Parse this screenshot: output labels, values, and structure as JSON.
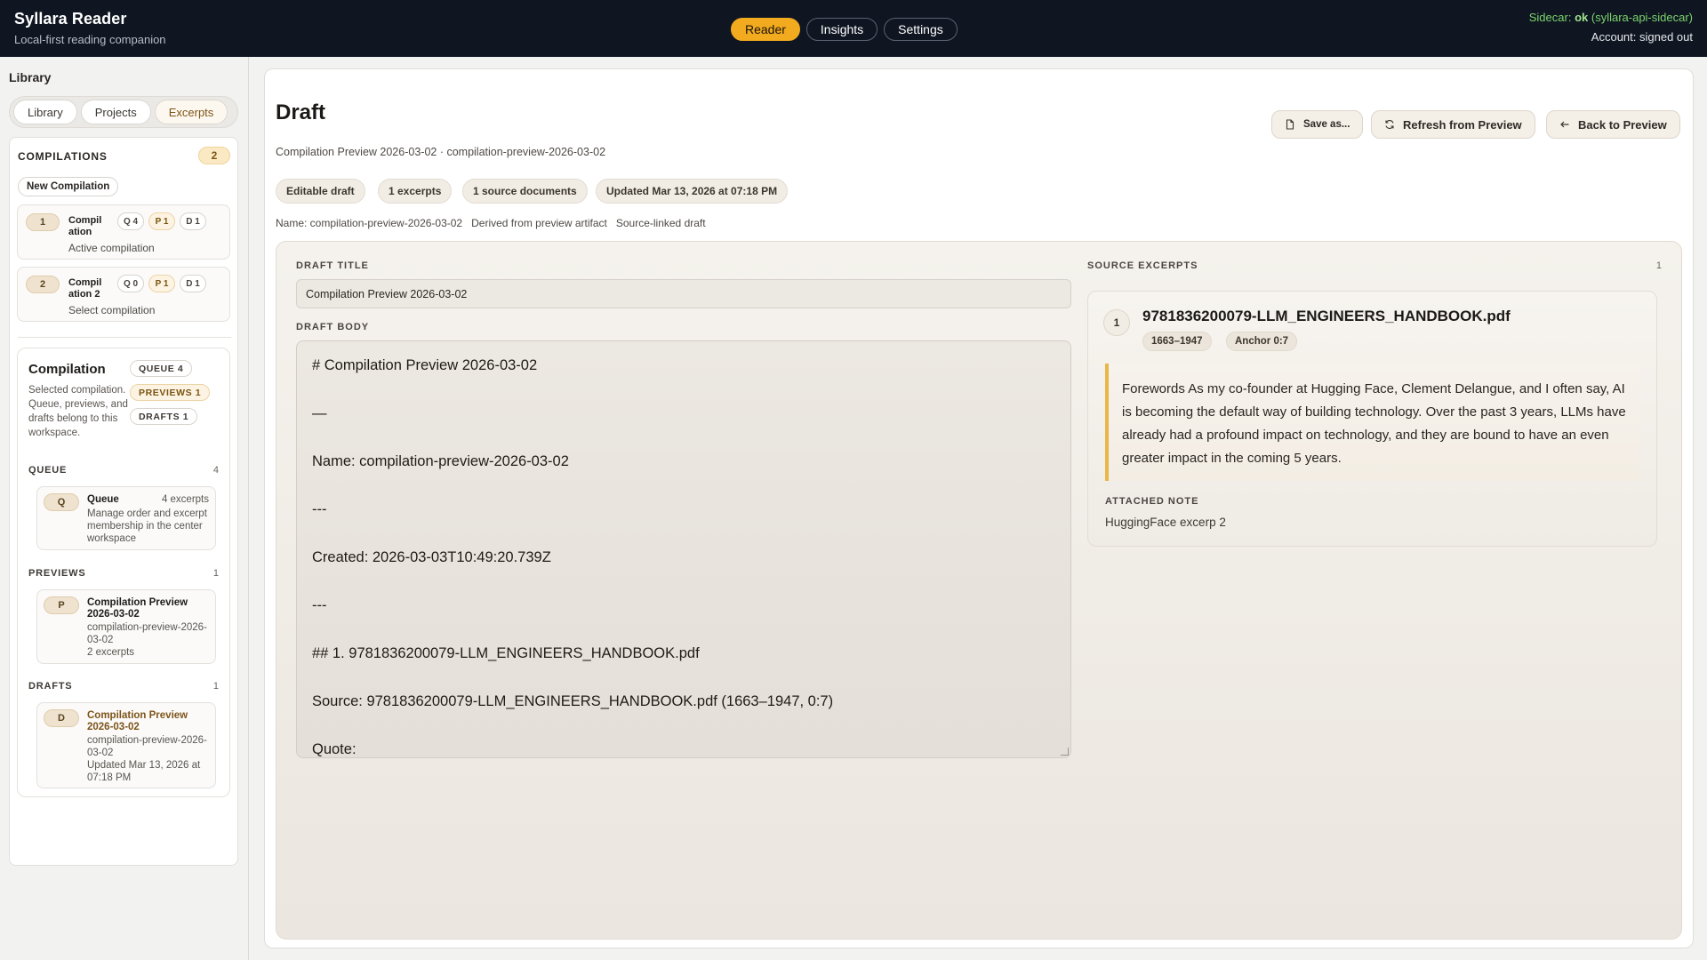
{
  "app": {
    "title": "Syllara Reader",
    "subtitle": "Local-first reading companion"
  },
  "nav": {
    "tabs": [
      {
        "label": "Reader",
        "active": true
      },
      {
        "label": "Insights",
        "active": false
      },
      {
        "label": "Settings",
        "active": false
      }
    ]
  },
  "status": {
    "sidecar_label": "Sidecar:",
    "sidecar_state": "ok",
    "sidecar_name": "(syllara-api-sidecar)",
    "account": "Account: signed out"
  },
  "sidebar": {
    "title": "Library",
    "tabs": [
      {
        "label": "Library",
        "active": false
      },
      {
        "label": "Projects",
        "active": false
      },
      {
        "label": "Excerpts",
        "active": true
      }
    ],
    "compilations_heading": "COMPILATIONS",
    "compilations_count": "2",
    "new_compilation_label": "New Compilation",
    "compilations": [
      {
        "num": "1",
        "name": "Compil ation",
        "q": "Q 4",
        "p": "P 1",
        "d": "D 1",
        "sub": "Active compilation"
      },
      {
        "num": "2",
        "name": "Compil ation 2",
        "q": "Q 0",
        "p": "P 1",
        "d": "D 1",
        "sub": "Select compilation"
      }
    ],
    "detail": {
      "title": "Compilation",
      "description": "Selected compilation. Queue, previews, and drafts belong to this workspace.",
      "pills": [
        "QUEUE 4",
        "PREVIEWS 1",
        "DRAFTS 1"
      ],
      "queue_heading": "QUEUE",
      "queue_count": "4",
      "queue_item": {
        "letter": "Q",
        "title": "Queue",
        "right": "4 excerpts",
        "meta": "Manage order and excerpt membership in the center workspace"
      },
      "previews_heading": "PREVIEWS",
      "previews_count": "1",
      "preview_item": {
        "letter": "P",
        "title": "Compilation Preview 2026-03-02",
        "meta1": "compilation-preview-2026-03-02",
        "meta2": "2 excerpts"
      },
      "drafts_heading": "DRAFTS",
      "drafts_count": "1",
      "draft_item": {
        "letter": "D",
        "title": "Compilation Preview 2026-03-02",
        "meta1": "compilation-preview-2026-03-02",
        "meta2": "Updated Mar 13, 2026 at 07:18 PM"
      }
    }
  },
  "main": {
    "title": "Draft",
    "subtitle": "Compilation Preview 2026-03-02 · compilation-preview-2026-03-02",
    "buttons": {
      "save_as": "Save as...",
      "refresh": "Refresh from Preview",
      "back": "Back to Preview"
    },
    "tags": [
      "Editable draft",
      "1 excerpts",
      "1 source documents",
      "Updated Mar 13, 2026 at 07:18 PM"
    ],
    "meta": [
      "Name: compilation-preview-2026-03-02",
      "Derived from preview artifact",
      "Source-linked draft"
    ],
    "draft_title_label": "DRAFT TITLE",
    "draft_title_value": "Compilation Preview 2026-03-02",
    "draft_body_label": "DRAFT BODY",
    "draft_body_lines": [
      "# Compilation Preview 2026-03-02",
      "—",
      "Name: compilation-preview-2026-03-02",
      "---",
      "Created: 2026-03-03T10:49:20.739Z",
      "---",
      "## 1. 9781836200079-LLM_ENGINEERS_HANDBOOK.pdf",
      "Source: 9781836200079-LLM_ENGINEERS_HANDBOOK.pdf (1663–1947, 0:7)",
      "Quote:"
    ],
    "source_excerpts_label": "SOURCE EXCERPTS",
    "source_excerpts_count": "1",
    "excerpt": {
      "num": "1",
      "title": "9781836200079-LLM_ENGINEERS_HANDBOOK.pdf",
      "range": "1663–1947",
      "anchor": "Anchor 0:7",
      "quote": "Forewords As my co-founder at Hugging Face, Clement Delangue, and I often say, AI is becoming the default way of building technology. Over the past 3 years, LLMs have already had a profound impact on technology, and they are bound to have an even greater impact in the coming 5 years.",
      "note_label": "ATTACHED NOTE",
      "note": "HuggingFace excerp 2"
    }
  },
  "colors": {
    "topbar": "#0f1622",
    "accent": "#f2aa1f",
    "status_ok": "#7bd36c",
    "quote_border": "#e9b64a"
  },
  "icons": [
    "document-icon",
    "refresh-icon",
    "arrow-left-icon",
    "resize-handle-icon"
  ]
}
